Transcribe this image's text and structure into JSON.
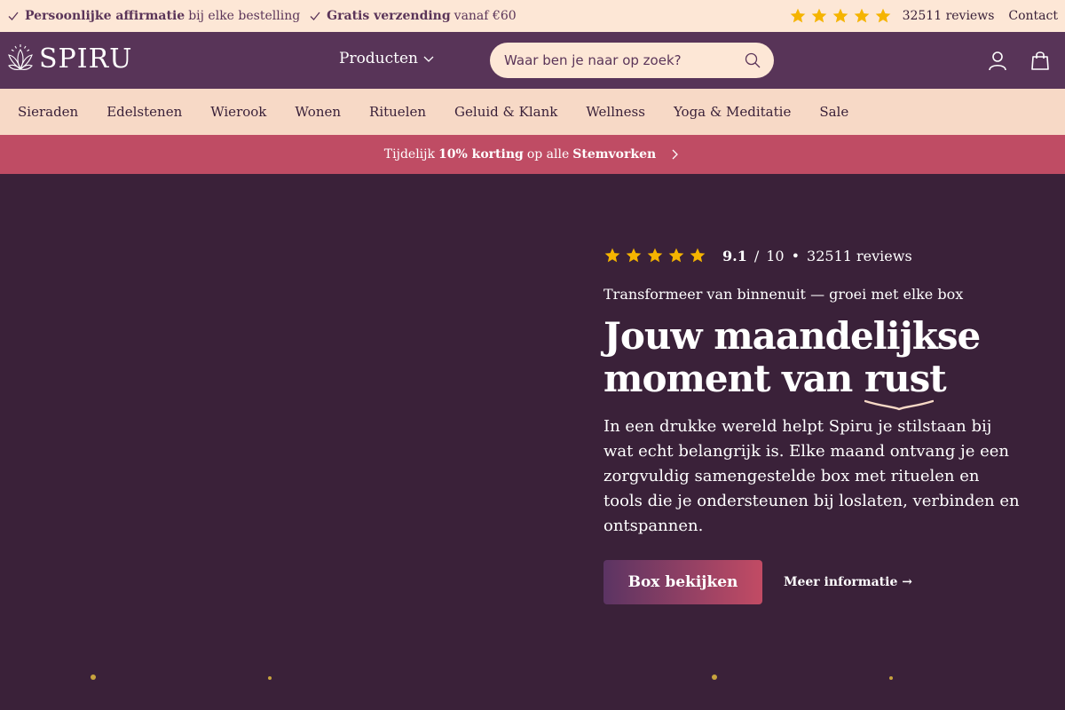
{
  "topbar": {
    "usp1_bold": "Persoonlijke affirmatie",
    "usp1_rest": "bij elke bestelling",
    "usp2_bold": "Gratis verzending",
    "usp2_rest": "vanaf €60",
    "rating_stars": 5,
    "reviews": "32511 reviews",
    "contact": "Contact"
  },
  "header": {
    "logo": "SPIRU",
    "products": "Producten",
    "search_placeholder": "Waar ben je naar op zoek?"
  },
  "categories": [
    "Sieraden",
    "Edelstenen",
    "Wierook",
    "Wonen",
    "Rituelen",
    "Geluid & Klank",
    "Wellness",
    "Yoga & Meditatie",
    "Sale"
  ],
  "promo": {
    "pre": "Tijdelijk",
    "bold1": "10% korting",
    "mid": "op alle",
    "bold2": "Stemvorken"
  },
  "hero": {
    "score": "9.1",
    "slash": "/",
    "max": "10",
    "dot": "•",
    "reviews": "32511 reviews",
    "eyebrow": "Transformeer van binnenuit — groei met elke box",
    "headline_1": "Jouw maandelijkse",
    "headline_2": "moment van",
    "headline_3": "rust",
    "description": "In een drukke wereld helpt Spiru je stilstaan bij wat echt belangrijk is. Elke maand ontvang je een zorgvuldig samengestelde box met rituelen en tools die je ondersteunen bij loslaten, verbinden en ontspannen.",
    "cta": "Box bekijken",
    "more": "Meer informatie →"
  },
  "colors": {
    "topbar_bg": "#fde7d6",
    "header_bg": "#583458",
    "catnav_bg": "#f7d9c6",
    "promo_bg": "#bf4c64",
    "hero_bg": "#3a2139",
    "star": "#f5b400",
    "accent_gold": "#c8a33e"
  }
}
